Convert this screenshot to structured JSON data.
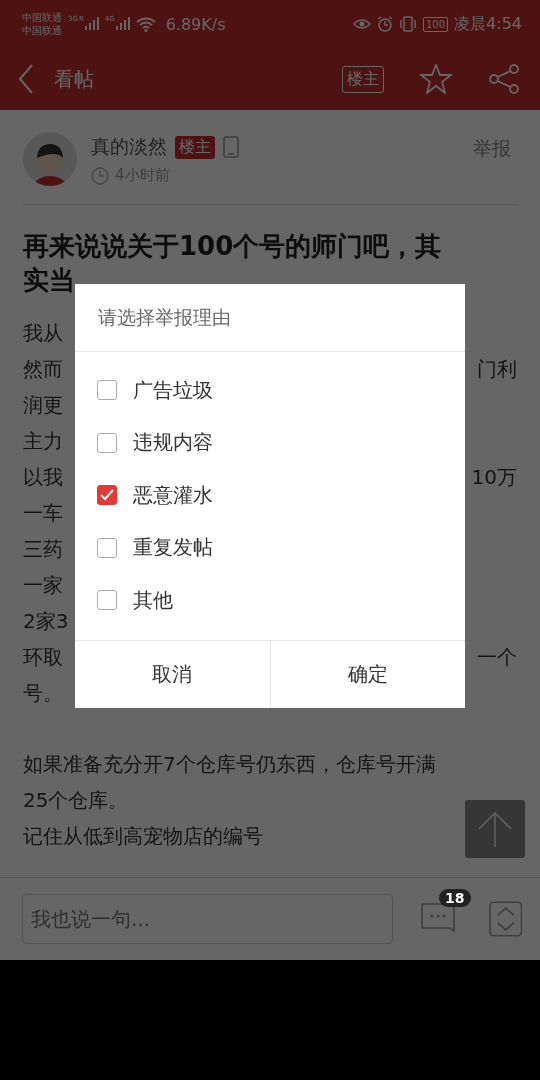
{
  "status_bar": {
    "carriers": [
      "中国联通",
      "中国联通"
    ],
    "network_1": "3G",
    "roaming": "R",
    "network_2": "4G",
    "speed": "6.89K/s",
    "battery": "100",
    "time": "凌晨4:54"
  },
  "header": {
    "title": "看帖",
    "owner_filter": "楼主"
  },
  "post": {
    "author": "真的淡然",
    "owner_badge": "楼主",
    "time": "4小时前",
    "report": "举报",
    "title_lines": [
      "再来说说关于100个号的师门吧，其",
      "实当"
    ],
    "paragraphs": [
      [
        {
          "left": "我从"
        },
        {
          "left": "然而",
          "right": "门利"
        },
        {
          "left": "润更"
        },
        {
          "left": "主力"
        },
        {
          "left": "以我",
          "right": "10万"
        },
        {
          "left": "一车"
        },
        {
          "left": "三药"
        },
        {
          "left": "一家"
        },
        {
          "left": "2家3"
        },
        {
          "left": "环取",
          "right": "一个"
        },
        {
          "left": "号。"
        }
      ],
      [
        {
          "left": "如果准备充分开7个仓库号仍东西，仓库号开满"
        },
        {
          "left": "25个仓库。"
        },
        {
          "left": "记住从低到高宠物店的编号"
        }
      ]
    ]
  },
  "dialog": {
    "title": "请选择举报理由",
    "options": [
      {
        "label": "广告垃圾",
        "checked": false
      },
      {
        "label": "违规内容",
        "checked": false
      },
      {
        "label": "恶意灌水",
        "checked": true
      },
      {
        "label": "重复发帖",
        "checked": false
      },
      {
        "label": "其他",
        "checked": false
      }
    ],
    "buttons": [
      "取消",
      "确定"
    ]
  },
  "comment_bar": {
    "placeholder": "我也说一句...",
    "comment_count": "18"
  }
}
